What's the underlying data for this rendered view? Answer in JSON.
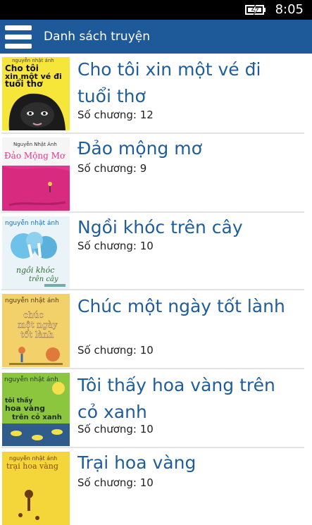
{
  "status_bar": {
    "time": "8:05",
    "battery_icon": "battery-charging-icon"
  },
  "app_bar": {
    "title": "Danh sách truyện",
    "menu_icon": "hamburger-menu-icon"
  },
  "colors": {
    "accent": "#1e5a9a",
    "title_text": "#1f5e9a"
  },
  "stories": [
    {
      "title": "Cho tôi xin một vé đi tuổi thơ",
      "chapters": "Số chương: 12",
      "cover": {
        "author": "nguyễn nhật ánh",
        "title_line1": "Cho tôi",
        "title_line2": "xin một vé đi",
        "title_line3": "tuổi thơ"
      }
    },
    {
      "title": "Đảo mộng mơ",
      "chapters": "Số chương: 9",
      "cover": {
        "author": "Nguyễn Nhật Ánh",
        "title_line1": "Đảo Mộng Mơ"
      }
    },
    {
      "title": "Ngồi khóc trên cây",
      "chapters": "Số chương: 10",
      "cover": {
        "author": "nguyễn nhật ánh",
        "title_line1": "ngồi khóc",
        "title_line2": "trên cây"
      }
    },
    {
      "title": "Chúc một ngày tốt lành",
      "chapters": "Số chương: 10",
      "cover": {
        "author": "nguyễn nhật ánh",
        "title_line1": "chúc",
        "title_line2": "một ngày",
        "title_line3": "tốt lành"
      }
    },
    {
      "title": "Tôi thấy hoa vàng trên cỏ xanh",
      "chapters": "Số chương: 10",
      "cover": {
        "author": "nguyễn nhật ánh",
        "title_line1": "tôi thấy",
        "title_line2": "hoa vàng",
        "title_line3": "trên cỏ xanh"
      }
    },
    {
      "title": "Trại hoa vàng",
      "chapters": "Số chương: 10",
      "cover": {
        "author": "nguyễn nhật ánh",
        "title_line1": "trại hoa vàng"
      }
    }
  ]
}
